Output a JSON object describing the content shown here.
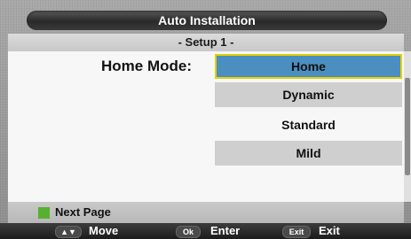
{
  "header": {
    "title": "Auto Installation",
    "subtitle": "- Setup 1 -"
  },
  "main": {
    "label": "Home Mode:",
    "options": [
      {
        "label": "Home",
        "selected": true
      },
      {
        "label": "Dynamic",
        "selected": false
      },
      {
        "label": "Standard",
        "selected": false
      },
      {
        "label": "Mild",
        "selected": false
      }
    ]
  },
  "footer": {
    "next_page": "Next Page",
    "hints": [
      {
        "key": "▲▼",
        "label": "Move"
      },
      {
        "key": "Ok",
        "label": "Enter"
      },
      {
        "key": "Exit",
        "label": "Exit"
      }
    ]
  },
  "colors": {
    "selected_option": "#4a8fc0",
    "selected_border": "#e6d000",
    "green_key": "#58b030"
  }
}
